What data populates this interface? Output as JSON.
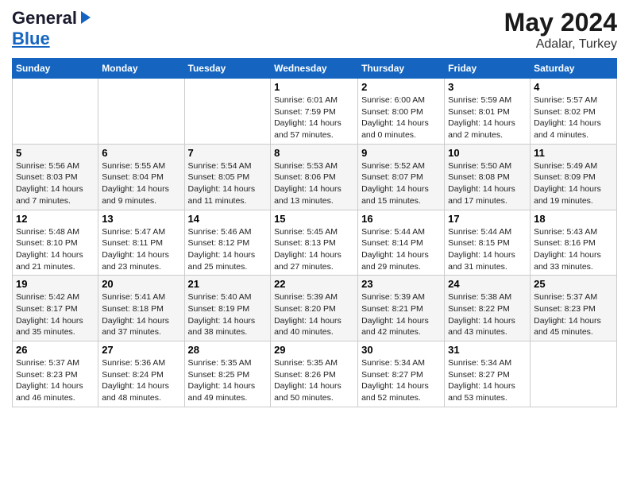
{
  "header": {
    "logo_general": "General",
    "logo_blue": "Blue",
    "month_year": "May 2024",
    "location": "Adalar, Turkey"
  },
  "days_of_week": [
    "Sunday",
    "Monday",
    "Tuesday",
    "Wednesday",
    "Thursday",
    "Friday",
    "Saturday"
  ],
  "weeks": [
    [
      {
        "day": "",
        "info": ""
      },
      {
        "day": "",
        "info": ""
      },
      {
        "day": "",
        "info": ""
      },
      {
        "day": "1",
        "info": "Sunrise: 6:01 AM\nSunset: 7:59 PM\nDaylight: 14 hours\nand 57 minutes."
      },
      {
        "day": "2",
        "info": "Sunrise: 6:00 AM\nSunset: 8:00 PM\nDaylight: 14 hours\nand 0 minutes."
      },
      {
        "day": "3",
        "info": "Sunrise: 5:59 AM\nSunset: 8:01 PM\nDaylight: 14 hours\nand 2 minutes."
      },
      {
        "day": "4",
        "info": "Sunrise: 5:57 AM\nSunset: 8:02 PM\nDaylight: 14 hours\nand 4 minutes."
      }
    ],
    [
      {
        "day": "5",
        "info": "Sunrise: 5:56 AM\nSunset: 8:03 PM\nDaylight: 14 hours\nand 7 minutes."
      },
      {
        "day": "6",
        "info": "Sunrise: 5:55 AM\nSunset: 8:04 PM\nDaylight: 14 hours\nand 9 minutes."
      },
      {
        "day": "7",
        "info": "Sunrise: 5:54 AM\nSunset: 8:05 PM\nDaylight: 14 hours\nand 11 minutes."
      },
      {
        "day": "8",
        "info": "Sunrise: 5:53 AM\nSunset: 8:06 PM\nDaylight: 14 hours\nand 13 minutes."
      },
      {
        "day": "9",
        "info": "Sunrise: 5:52 AM\nSunset: 8:07 PM\nDaylight: 14 hours\nand 15 minutes."
      },
      {
        "day": "10",
        "info": "Sunrise: 5:50 AM\nSunset: 8:08 PM\nDaylight: 14 hours\nand 17 minutes."
      },
      {
        "day": "11",
        "info": "Sunrise: 5:49 AM\nSunset: 8:09 PM\nDaylight: 14 hours\nand 19 minutes."
      }
    ],
    [
      {
        "day": "12",
        "info": "Sunrise: 5:48 AM\nSunset: 8:10 PM\nDaylight: 14 hours\nand 21 minutes."
      },
      {
        "day": "13",
        "info": "Sunrise: 5:47 AM\nSunset: 8:11 PM\nDaylight: 14 hours\nand 23 minutes."
      },
      {
        "day": "14",
        "info": "Sunrise: 5:46 AM\nSunset: 8:12 PM\nDaylight: 14 hours\nand 25 minutes."
      },
      {
        "day": "15",
        "info": "Sunrise: 5:45 AM\nSunset: 8:13 PM\nDaylight: 14 hours\nand 27 minutes."
      },
      {
        "day": "16",
        "info": "Sunrise: 5:44 AM\nSunset: 8:14 PM\nDaylight: 14 hours\nand 29 minutes."
      },
      {
        "day": "17",
        "info": "Sunrise: 5:44 AM\nSunset: 8:15 PM\nDaylight: 14 hours\nand 31 minutes."
      },
      {
        "day": "18",
        "info": "Sunrise: 5:43 AM\nSunset: 8:16 PM\nDaylight: 14 hours\nand 33 minutes."
      }
    ],
    [
      {
        "day": "19",
        "info": "Sunrise: 5:42 AM\nSunset: 8:17 PM\nDaylight: 14 hours\nand 35 minutes."
      },
      {
        "day": "20",
        "info": "Sunrise: 5:41 AM\nSunset: 8:18 PM\nDaylight: 14 hours\nand 37 minutes."
      },
      {
        "day": "21",
        "info": "Sunrise: 5:40 AM\nSunset: 8:19 PM\nDaylight: 14 hours\nand 38 minutes."
      },
      {
        "day": "22",
        "info": "Sunrise: 5:39 AM\nSunset: 8:20 PM\nDaylight: 14 hours\nand 40 minutes."
      },
      {
        "day": "23",
        "info": "Sunrise: 5:39 AM\nSunset: 8:21 PM\nDaylight: 14 hours\nand 42 minutes."
      },
      {
        "day": "24",
        "info": "Sunrise: 5:38 AM\nSunset: 8:22 PM\nDaylight: 14 hours\nand 43 minutes."
      },
      {
        "day": "25",
        "info": "Sunrise: 5:37 AM\nSunset: 8:23 PM\nDaylight: 14 hours\nand 45 minutes."
      }
    ],
    [
      {
        "day": "26",
        "info": "Sunrise: 5:37 AM\nSunset: 8:23 PM\nDaylight: 14 hours\nand 46 minutes."
      },
      {
        "day": "27",
        "info": "Sunrise: 5:36 AM\nSunset: 8:24 PM\nDaylight: 14 hours\nand 48 minutes."
      },
      {
        "day": "28",
        "info": "Sunrise: 5:35 AM\nSunset: 8:25 PM\nDaylight: 14 hours\nand 49 minutes."
      },
      {
        "day": "29",
        "info": "Sunrise: 5:35 AM\nSunset: 8:26 PM\nDaylight: 14 hours\nand 50 minutes."
      },
      {
        "day": "30",
        "info": "Sunrise: 5:34 AM\nSunset: 8:27 PM\nDaylight: 14 hours\nand 52 minutes."
      },
      {
        "day": "31",
        "info": "Sunrise: 5:34 AM\nSunset: 8:27 PM\nDaylight: 14 hours\nand 53 minutes."
      },
      {
        "day": "",
        "info": ""
      }
    ]
  ]
}
